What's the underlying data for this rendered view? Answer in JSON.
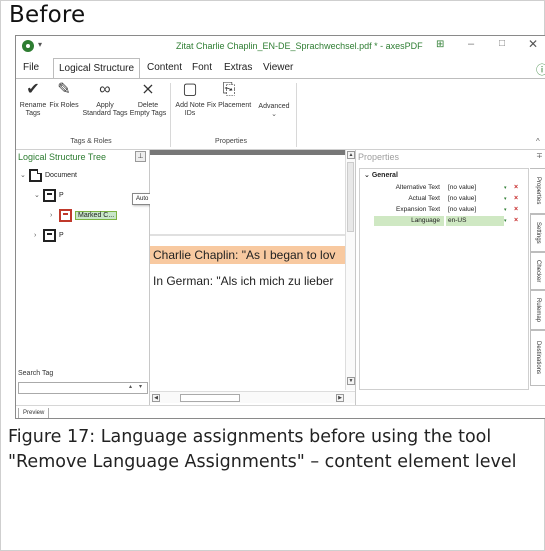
{
  "heading": "Before",
  "caption": "Figure 17: Language assignments before using the tool \"Remove Language Assignments\" – content element level",
  "window": {
    "title": "Zitat Charlie Chaplin_EN-DE_Sprachwechsel.pdf * - axesPDF",
    "qa_arrow": "▾",
    "grid_glyph": "⊞",
    "min_glyph": "–",
    "max_glyph": "□",
    "close_glyph": "✕"
  },
  "menu": {
    "items": [
      "File",
      "Logical Structure",
      "Content",
      "Font",
      "Extras",
      "Viewer"
    ],
    "active": "Logical Structure",
    "help_glyph": "ⓘ"
  },
  "ribbon": {
    "buttons": [
      {
        "label": "Rename\nTags",
        "icon": "rename-tags-icon"
      },
      {
        "label": "Fix Roles",
        "icon": "fix-roles-icon"
      },
      {
        "label": "Apply\nStandard Tags",
        "icon": "apply-standard-tags-icon"
      },
      {
        "label": "Delete\nEmpty Tags",
        "icon": "delete-empty-tags-icon"
      },
      {
        "label": "Add Note\nIDs",
        "icon": "add-note-ids-icon"
      },
      {
        "label": "Fix Placement",
        "icon": "fix-placement-icon"
      },
      {
        "label": "Advanced",
        "icon": "chevron-down-icon"
      }
    ],
    "groups": [
      "Tags & Roles",
      "Properties"
    ],
    "collapse_glyph": "^"
  },
  "left_panel": {
    "title": "Logical Structure Tree",
    "pin_glyph": "⊥",
    "tree": [
      {
        "label": "Document",
        "chevron": "⌄"
      },
      {
        "label": "P",
        "chevron": "⌄"
      },
      {
        "label": "Marked C...",
        "chevron": "›"
      },
      {
        "label": "P",
        "chevron": "›"
      }
    ],
    "tooltip": "Auto Hide",
    "search_label": "Search Tag",
    "search_value": "",
    "search_up": "▴",
    "search_dd": "▾"
  },
  "document": {
    "line1": "Charlie Chaplin: \"As I began to lov",
    "line2": "In German: \"Als ich mich zu lieber",
    "scroll_up": "▲",
    "scroll_down": "▼",
    "scroll_left": "◀",
    "scroll_right": "▶"
  },
  "right_panel": {
    "title": "Properties",
    "pin_glyph": "∓",
    "group": "General",
    "group_chevron": "⌄",
    "rows": [
      {
        "name": "Alternative Text",
        "value": "[no value]"
      },
      {
        "name": "Actual Text",
        "value": "[no value]"
      },
      {
        "name": "Expansion Text",
        "value": "[no value]"
      },
      {
        "name": "Language",
        "value": "en-US"
      }
    ],
    "dd_glyph": "▾",
    "x_glyph": "×",
    "side_tabs": [
      "Properties",
      "Settings",
      "Checker",
      "Rulemap",
      "Destinations"
    ]
  },
  "status": {
    "preview_tab": "Preview"
  },
  "colors": {
    "accent": "#2e7d32",
    "highlight": "#f8c9a0",
    "selection": "#cfe8c3",
    "remove": "#c62828"
  }
}
